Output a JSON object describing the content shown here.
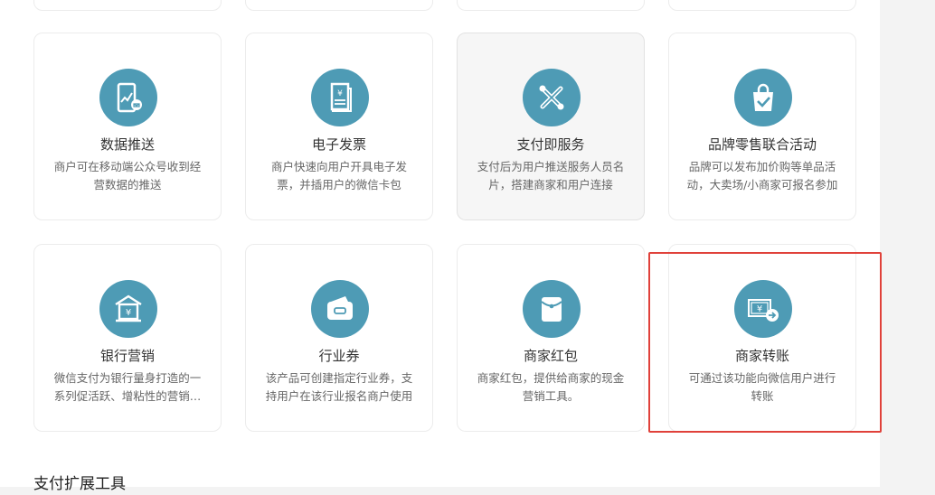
{
  "cards": [
    {
      "title": "数据推送",
      "desc": "商户可在移动端公众号收到经营数据的推送",
      "icon": "phone-chart-icon"
    },
    {
      "title": "电子发票",
      "desc": "商户快速向用户开具电子发票，并插用户的微信卡包",
      "icon": "invoice-icon"
    },
    {
      "title": "支付即服务",
      "desc": "支付后为用户推送服务人员名片，搭建商家和用户连接",
      "icon": "service-link-icon"
    },
    {
      "title": "品牌零售联合活动",
      "desc": "品牌可以发布加价购等单品活动，大卖场/小商家可报名参加",
      "icon": "shopping-bag-icon"
    },
    {
      "title": "银行营销",
      "desc": "微信支付为银行量身打造的一系列促活跃、增粘性的营销工具",
      "icon": "bank-icon"
    },
    {
      "title": "行业券",
      "desc": "该产品可创建指定行业券，支持用户在该行业报名商户使用",
      "icon": "wallet-coupon-icon"
    },
    {
      "title": "商家红包",
      "desc": "商家红包，提供给商家的现金营销工具。",
      "icon": "red-packet-icon"
    },
    {
      "title": "商家转账",
      "desc": "可通过该功能向微信用户进行转账",
      "icon": "transfer-icon"
    }
  ],
  "section": {
    "title": "支付扩展工具"
  },
  "theme": {
    "accent": "#4e9bb5",
    "highlight": "#e0413a"
  }
}
